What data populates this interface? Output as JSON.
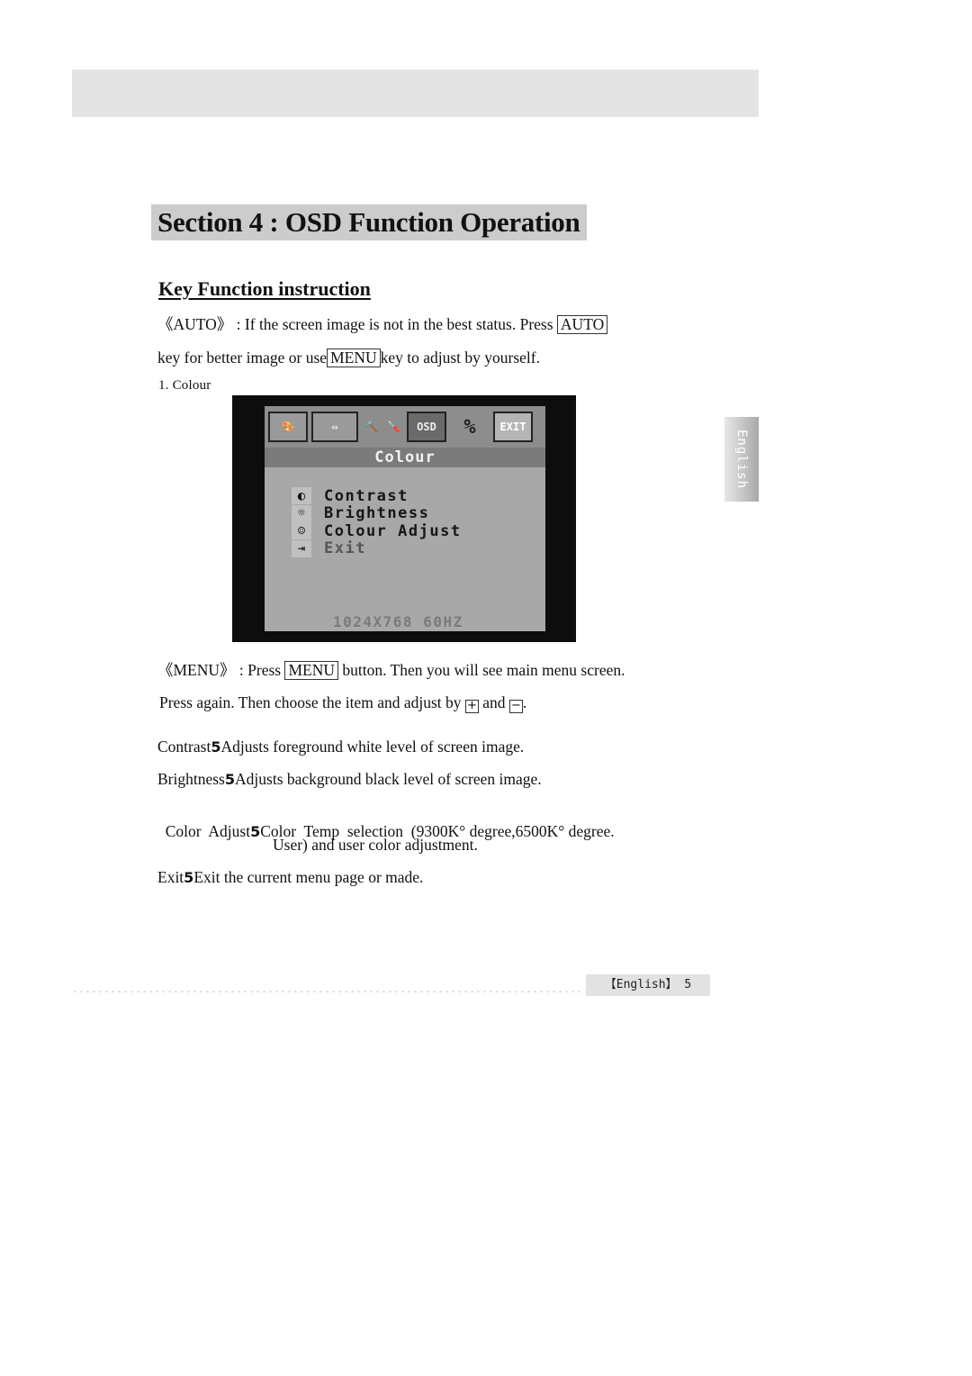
{
  "header": {
    "section_title": "Section 4 : OSD Function Operation"
  },
  "key_function": {
    "heading": "Key Function instruction",
    "auto": {
      "tag": "《AUTO》",
      "line1_text": ": If the screen image is not in the best status. Press",
      "key_auto": "AUTO",
      "line2_pre": "key for better image or use",
      "key_menu": "MENU",
      "line2_post": "key to adjust by yourself."
    },
    "figure_label": "1. Colour",
    "menu": {
      "tag": "《MENU》",
      "line1_pre": ": Press",
      "key_menu": "MENU",
      "line1_post": "button. Then you will see main menu screen.",
      "line2_pre": "Press again. Then choose the item and adjust by",
      "plus_key": "+",
      "and": "and",
      "minus_key": "−",
      "line2_post": "."
    },
    "separator": "5",
    "definitions": [
      {
        "term": "Contrast",
        "desc": "Adjusts foreground white level of screen image."
      },
      {
        "term": "Brightness",
        "desc": "Adjusts background black level of screen image."
      },
      {
        "term": "Color  Adjust",
        "desc": "Color  Temp  selection  (9300K° degree,6500K° degree."
      },
      {
        "term": "",
        "desc": "User) and user color adjustment."
      },
      {
        "term": "Exit",
        "desc": "Exit the current menu page or made."
      }
    ]
  },
  "osd_screen": {
    "icons": [
      {
        "name": "palette-icon",
        "glyph": "🎨"
      },
      {
        "name": "position-icon",
        "glyph": "⇔"
      },
      {
        "name": "tools-icon",
        "glyph": "🔨"
      },
      {
        "name": "screwdriver-icon",
        "glyph": "🪛"
      },
      {
        "name": "osd-icon",
        "glyph": "OSD"
      },
      {
        "name": "reset-icon",
        "glyph": "%"
      },
      {
        "name": "exit-icon",
        "glyph": "EXIT"
      }
    ],
    "title": "Colour",
    "items": [
      {
        "icon": "◐",
        "label": "Contrast"
      },
      {
        "icon": "☼",
        "label": "Brightness"
      },
      {
        "icon": "☺",
        "label": "Colour Adjust"
      },
      {
        "icon": "⇥",
        "label": "Exit"
      }
    ],
    "resolution": "1024X768   60HZ"
  },
  "side_tab": {
    "label": "English"
  },
  "footer": {
    "page_label": "【English】 5"
  }
}
